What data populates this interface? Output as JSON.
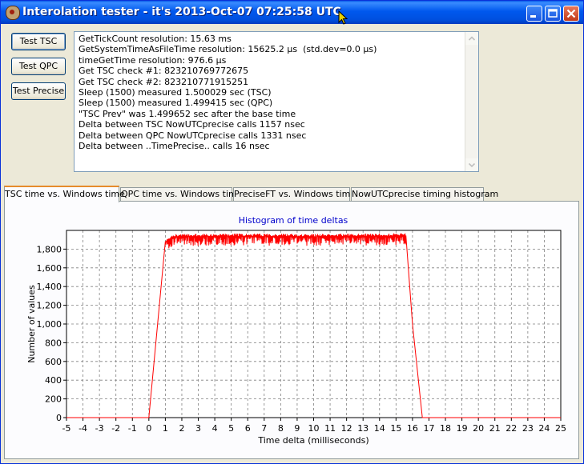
{
  "window": {
    "title": "Interolation tester - it's 2013-Oct-07 07:25:58 UTC"
  },
  "buttons": {
    "tsc": "Test TSC",
    "qpc": "Test QPC",
    "precise": "Test Precise"
  },
  "log": {
    "lines": [
      "GetTickCount resolution: 15.63 ms",
      "GetSystemTimeAsFileTime resolution: 15625.2 µs  (std.dev=0.0 µs)",
      "timeGetTime resolution: 976.6 µs",
      "Get TSC check #1: 823210769772675",
      "Get TSC check #2: 823210771915251",
      "Sleep (1500) measured 1.500029 sec (TSC)",
      "Sleep (1500) measured 1.499415 sec (QPC)",
      "\"TSC Prev\" was 1.499652 sec after the base time",
      "Delta between TSC NowUTCprecise calls 1157 nsec",
      "Delta between QPC NowUTCprecise calls 1331 nsec",
      "Delta between ..TimePrecise.. calls 16 nsec"
    ]
  },
  "tabs": [
    {
      "label": "TSC time vs. Windows time"
    },
    {
      "label": "QPC time vs. Windows time"
    },
    {
      "label": "PreciseFT vs. Windows time"
    },
    {
      "label": "NowUTCprecise timing histogram"
    }
  ],
  "chart_data": {
    "type": "line",
    "title": "Histogram of time deltas",
    "xlabel": "Time delta (milliseconds)",
    "ylabel": "Number of values",
    "xlim": [
      -5,
      25
    ],
    "ylim": [
      0,
      2000
    ],
    "xticks": [
      -5,
      -4,
      -3,
      -2,
      -1,
      0,
      1,
      2,
      3,
      4,
      5,
      6,
      7,
      8,
      9,
      10,
      11,
      12,
      13,
      14,
      15,
      16,
      17,
      18,
      19,
      20,
      21,
      22,
      23,
      24,
      25
    ],
    "yticks": [
      0,
      200,
      400,
      600,
      800,
      1000,
      1200,
      1400,
      1600,
      1800
    ],
    "ytick_labels": [
      "0",
      "200",
      "400",
      "600",
      "800",
      "1,000",
      "1,200",
      "1,400",
      "1,600",
      "1,800"
    ],
    "grid": true,
    "series": [
      {
        "color": "#ff0000",
        "x": [
          -5,
          0,
          1,
          1.5,
          5,
          10,
          15.6,
          16,
          16.6,
          25
        ],
        "values": [
          0,
          0,
          1870,
          1935,
          1940,
          1935,
          1945,
          1000,
          0,
          0
        ]
      }
    ]
  },
  "colors": {
    "titlebar": "#0058ee",
    "series": "#ff0000",
    "chart_title": "#0000cc",
    "active_tab_accent": "#e68b2c"
  }
}
